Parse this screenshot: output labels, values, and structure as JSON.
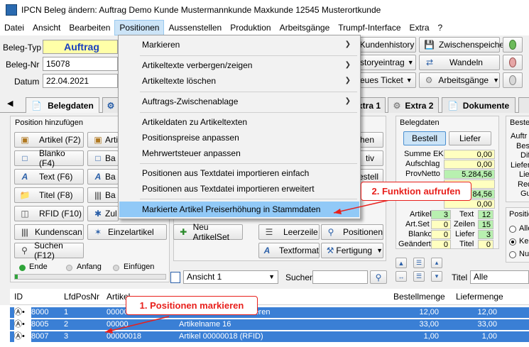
{
  "window": {
    "title": "IPCN Beleg ändern: Auftrag   Demo Kunde Mustermannkunde Maxkunde 12545 Musterortkunde"
  },
  "menubar": [
    "Datei",
    "Ansicht",
    "Bearbeiten",
    "Positionen",
    "Aussenstellen",
    "Produktion",
    "Arbeitsgänge",
    "Trumpf-Interface",
    "Extra",
    "?"
  ],
  "header": {
    "belegtyp_label": "Beleg-Typ",
    "belegtyp_value": "Auftrag",
    "belegnr_label": "Beleg-Nr",
    "belegnr_value": "15078",
    "datum_label": "Datum",
    "datum_value": "22.04.2021"
  },
  "right_toolbar": {
    "kundenhistory": "Kundenhistory",
    "zwischenspeichern": "Zwischenspeichern",
    "storyeintrag": "storyeintrag",
    "wandeln": "Wandeln",
    "eues_ticket": "eues Ticket",
    "arbeitsgaenge": "Arbeitsgänge"
  },
  "tabs": {
    "belegdaten": "Belegdaten",
    "extra1": "xtra 1",
    "extra2": "Extra 2",
    "dokumente": "Dokumente"
  },
  "position_hinzufuegen": {
    "title": "Position hinzufügen",
    "buttons_col1": [
      "Artikel (F2)",
      "Blanko (F4)",
      "Text (F6)",
      "Titel (F8)",
      "RFID (F10)",
      "Kundenscan",
      "Suchen (F12)"
    ],
    "buttons_col2": [
      "Arti",
      "Ba",
      "Ba",
      "Ba",
      "Zul",
      "Einzelartikel"
    ],
    "radio": [
      "Ende",
      "Anfang",
      "Einfügen"
    ]
  },
  "mid_buttons": {
    "neu_artikelset": "Neu ArtikelSet",
    "leerzeile": "Leerzeile",
    "positionen": "Positionen",
    "textformat": "Textformat",
    "fertigung": "Fertigung",
    "chen": "chen",
    "tiv": "tiv",
    "bestell": "Bestell",
    "ieren": "ieren"
  },
  "belegdaten_box": {
    "title": "Belegdaten",
    "bestell": "Bestell",
    "liefer": "Liefer",
    "rows": [
      {
        "label": "Summe EK",
        "value": "0,00"
      },
      {
        "label": "Aufschlag",
        "value": "0,00"
      },
      {
        "label": "ProvNetto",
        "value": "5.284,56"
      },
      {
        "label": "",
        "value": ""
      },
      {
        "label": "",
        "value": "84,56"
      },
      {
        "label": "",
        "value": "0,00"
      }
    ],
    "counts": [
      {
        "l1": "Artikel",
        "v1": "3",
        "l2": "Text",
        "v2": "12"
      },
      {
        "l1": "Art.Set",
        "v1": "0",
        "l2": "Zeilen",
        "v2": "15"
      },
      {
        "l1": "Blanko",
        "v1": "0",
        "l2": "Liefer",
        "v2": "3"
      },
      {
        "l1": "Geändert",
        "v1": "0",
        "l2": "Titel",
        "v2": "0"
      }
    ]
  },
  "right_edge": {
    "bestel": "Bestel",
    "labels": [
      "Auftr",
      "Best",
      "Dif",
      "Liefer",
      "Lief",
      "Red",
      "Gu"
    ],
    "positio": "Positio",
    "radio": [
      "Alle",
      "Kei",
      "Nu"
    ]
  },
  "view_bar": {
    "ansicht": "Ansicht 1",
    "suchen": "Suchen",
    "titel_label": "Titel",
    "titel_value": "Alle"
  },
  "dropdown_menu": {
    "items": [
      {
        "label": "Markieren",
        "submenu": true
      },
      {
        "label": "Artikeltexte verbergen/zeigen",
        "submenu": true
      },
      {
        "label": "Artikeltexte löschen",
        "submenu": true
      },
      {
        "label": "Auftrags-Zwischenablage",
        "submenu": true
      },
      {
        "label": "Artikeldaten zu Artikeltexten",
        "submenu": false
      },
      {
        "label": "Positionspreise anpassen",
        "submenu": false
      },
      {
        "label": "Mehrwertsteuer anpassen",
        "submenu": false
      },
      {
        "label": "Positionen aus Textdatei  importieren einfach",
        "submenu": false
      },
      {
        "label": "Positionen aus Textdatei  importieren erweitert",
        "submenu": false
      },
      {
        "label": "Markierte Artikel Preiserhöhung in Stammdaten",
        "submenu": false
      }
    ]
  },
  "grid": {
    "columns": [
      "ID",
      "LfdPosNr",
      "Artikel",
      "",
      "Bestellmenge",
      "Liefermenge"
    ],
    "rows": [
      {
        "id": "8000",
        "lfd": "1",
        "artikel": "00000",
        "text": "ieren",
        "bestell": "12,00",
        "liefer": "12,00"
      },
      {
        "id": "8005",
        "lfd": "2",
        "artikel": "00000",
        "text": "Artikelname 16",
        "bestell": "33,00",
        "liefer": "33,00"
      },
      {
        "id": "8007",
        "lfd": "3",
        "artikel": "00000018",
        "text": "Artikel 00000018  (RFID)",
        "bestell": "1,00",
        "liefer": "1,00"
      }
    ]
  },
  "callouts": {
    "step1": "1. Positionen markieren",
    "step2": "2. Funktion aufrufen"
  },
  "colors": {
    "callout": "#e8201c",
    "menu_highlight": "#91c9f7",
    "row_selected": "#3a7fd5",
    "field_yellow": "#ffffa8"
  }
}
